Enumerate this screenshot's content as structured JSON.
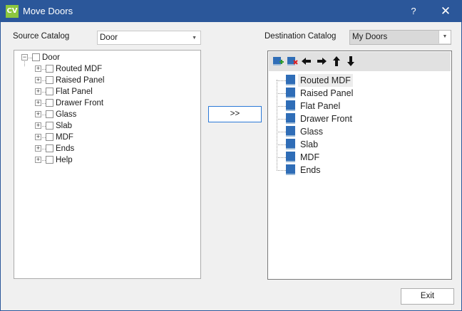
{
  "window": {
    "title": "Move Doors",
    "app_icon_text": "CV",
    "help_glyph": "?",
    "close_glyph": "✕"
  },
  "source": {
    "label": "Source Catalog",
    "selected": "Door",
    "tree": {
      "root": "Door",
      "items": [
        "Routed MDF",
        "Raised Panel",
        "Flat Panel",
        "Drawer Front",
        "Glass",
        "Slab",
        "MDF",
        "Ends",
        "Help"
      ]
    }
  },
  "move_button": {
    "label": ">>"
  },
  "destination": {
    "label": "Destination Catalog",
    "selected": "My Doors",
    "toolbar": [
      "add-folder-icon",
      "delete-folder-icon",
      "arrow-left-icon",
      "arrow-right-icon",
      "arrow-up-icon",
      "arrow-down-icon"
    ],
    "items": [
      "Routed MDF",
      "Raised Panel",
      "Flat Panel",
      "Drawer Front",
      "Glass",
      "Slab",
      "MDF",
      "Ends"
    ],
    "selected_item": "Routed MDF"
  },
  "exit_button": {
    "label": "Exit"
  },
  "colors": {
    "titlebar": "#2b579a",
    "app_icon": "#8cc63f",
    "doc_icon": "#2f6db7",
    "focus_border": "#2b79d7"
  }
}
